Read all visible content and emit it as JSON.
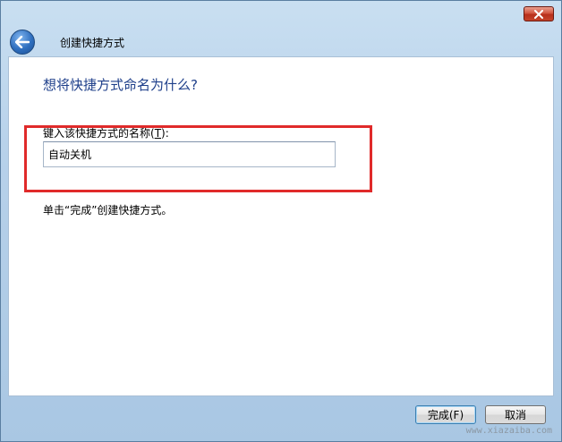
{
  "window": {
    "close_icon": "close-icon"
  },
  "nav": {
    "back_icon": "back-arrow-icon",
    "title": "创建快捷方式"
  },
  "main": {
    "heading": "想将快捷方式命名为什么?",
    "field_label_prefix": "键入该快捷方式的名称(",
    "field_label_hotkey": "T",
    "field_label_suffix": "):",
    "name_value": "自动关机",
    "hint": "单击“完成”创建快捷方式。"
  },
  "footer": {
    "finish_label": "完成(F)",
    "cancel_label": "取消"
  },
  "watermark": "www.xiazaiba.com",
  "colors": {
    "heading": "#1e3f8a",
    "highlight": "#e02a2a",
    "close_red": "#c4432b"
  }
}
